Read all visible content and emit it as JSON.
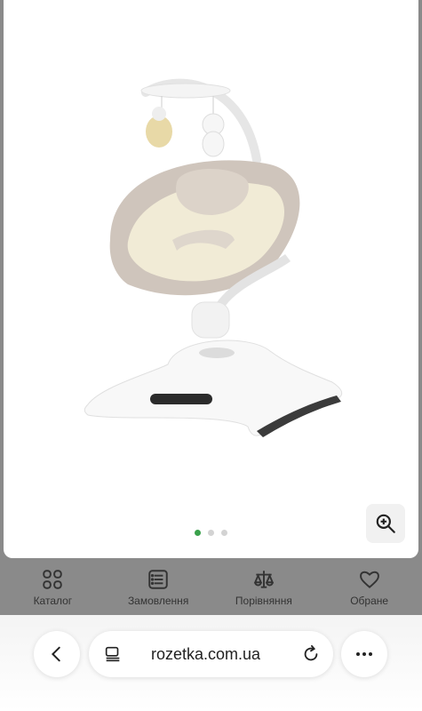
{
  "carousel": {
    "pages": 3,
    "active_index": 0,
    "accent": "#3aa14b"
  },
  "icons": {
    "zoom": "zoom-in-icon"
  },
  "bottom_nav": {
    "items": [
      {
        "label": "Каталог",
        "icon": "grid-icon"
      },
      {
        "label": "Замовлення",
        "icon": "orders-list-icon"
      },
      {
        "label": "Порівняння",
        "icon": "scales-icon"
      },
      {
        "label": "Обране",
        "icon": "heart-icon"
      }
    ]
  },
  "browser": {
    "url": "rozetka.com.ua"
  }
}
